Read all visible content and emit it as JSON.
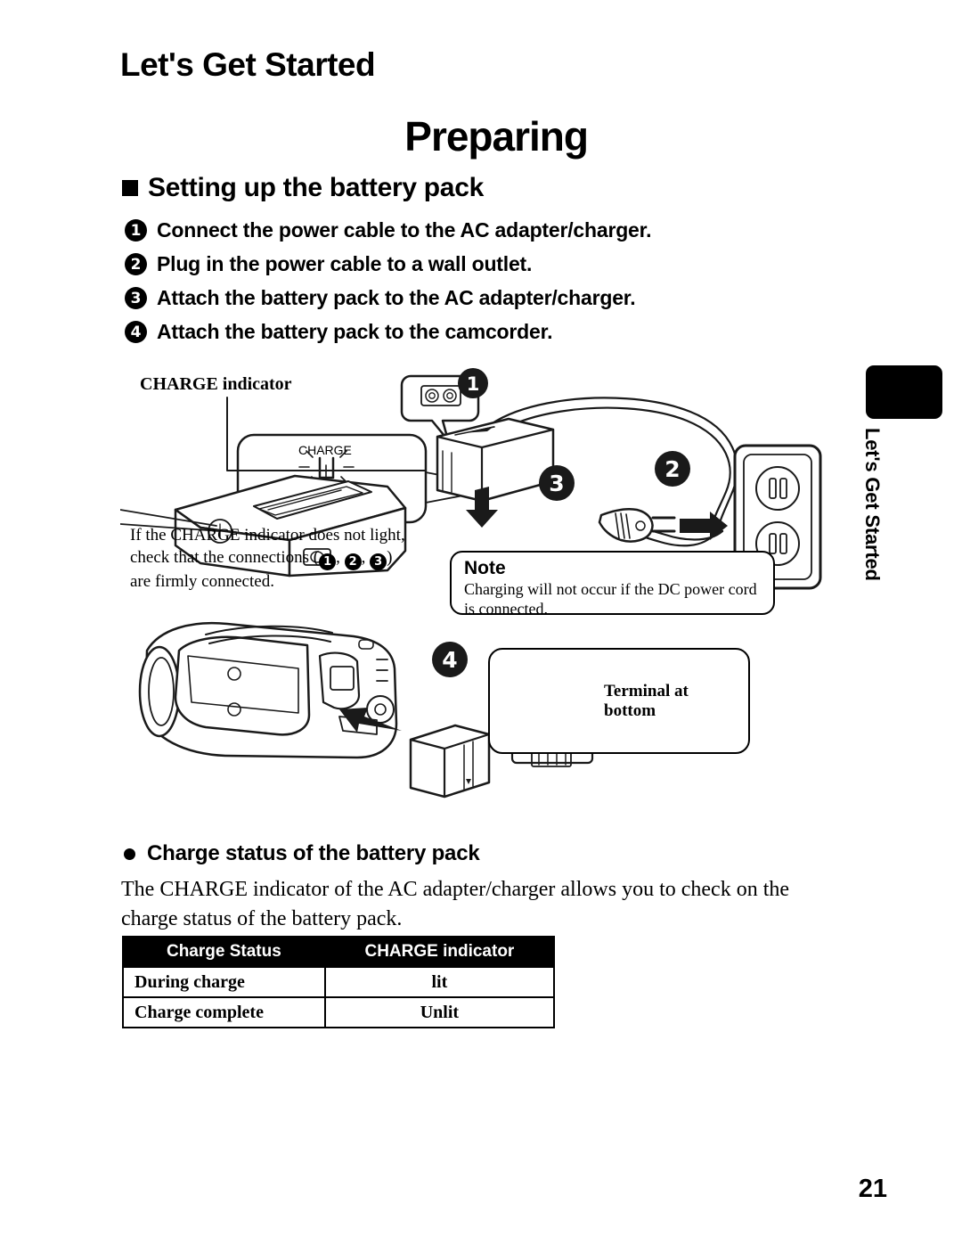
{
  "chapter_title": "Let's Get Started",
  "section_title": "Preparing",
  "subsection_title": "Setting up the battery pack",
  "steps": [
    {
      "number": "1",
      "text": "Connect the power cable to the AC adapter/charger."
    },
    {
      "number": "2",
      "text": "Plug in the power cable to a wall outlet."
    },
    {
      "number": "3",
      "text": "Attach the battery pack to the AC adapter/charger."
    },
    {
      "number": "4",
      "text": "Attach the battery pack to the camcorder."
    }
  ],
  "diagram": {
    "charge_indicator_label": "CHARGE indicator",
    "charge_led_label": "CHARGE",
    "step_markers": [
      "1",
      "2",
      "3",
      "4"
    ]
  },
  "troubleshooting": {
    "line1": "If the CHARGE indicator does not light,",
    "line2_prefix": "check that the connections (",
    "line2_suffix": ")",
    "badges": [
      "1",
      "2",
      "3"
    ],
    "separator": ",",
    "line3": "are firmly connected."
  },
  "note": {
    "title": "Note",
    "body": "Charging will not occur if the DC power cord is connected."
  },
  "terminal_callout": {
    "line1": "Terminal at",
    "line2": "bottom"
  },
  "thumb_tab": {
    "label": "Let's Get Started"
  },
  "charge_status": {
    "heading": "Charge status of the battery pack",
    "body": "The CHARGE indicator of the AC adapter/charger allows you to check on the charge status of the battery pack.",
    "table": {
      "headers": [
        "Charge Status",
        "CHARGE indicator"
      ],
      "rows": [
        [
          "During charge",
          "lit"
        ],
        [
          "Charge complete",
          "Unlit"
        ]
      ]
    }
  },
  "page_number": "21"
}
